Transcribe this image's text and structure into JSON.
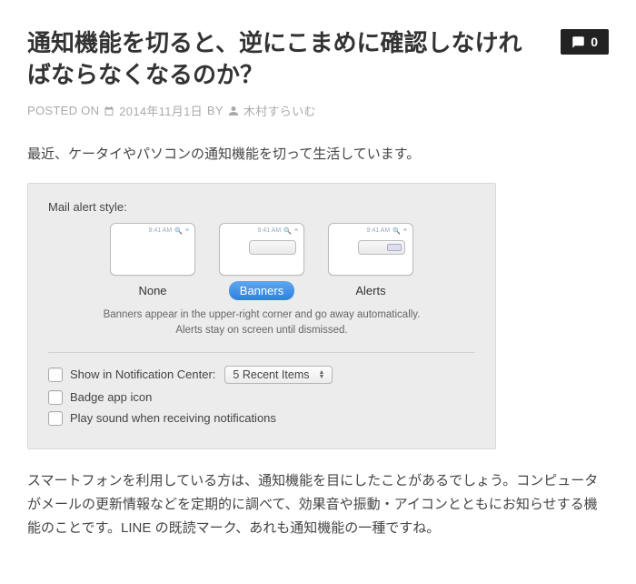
{
  "post": {
    "title": "通知機能を切ると、逆にこまめに確認しなければならなくなるのか？",
    "comments_count": "0",
    "meta": {
      "posted_on_label": "POSTED ON",
      "date": "2014年11月1日",
      "by_label": "BY",
      "author": "木村すらいむ"
    },
    "paragraphs": {
      "p1": "最近、ケータイやパソコンの通知機能を切って生活しています。",
      "p2": "スマートフォンを利用している方は、通知機能を目にしたことがあるでしょう。コンピュータがメールの更新情報などを定期的に調べて、効果音や振動・アイコンとともにお知らせする機能のことです。LINE の既読マーク、あれも通知機能の一種ですね。"
    }
  },
  "prefs": {
    "section_label": "Mail alert style:",
    "menubar_time": "9:41 AM",
    "options": {
      "none": "None",
      "banners": "Banners",
      "alerts": "Alerts"
    },
    "hint": "Banners appear in the upper-right corner and go away automatically. Alerts stay on screen until dismissed.",
    "show_in_nc": "Show in Notification Center:",
    "recent_items": "5 Recent Items",
    "badge": "Badge app icon",
    "play_sound": "Play sound when receiving notifications"
  }
}
